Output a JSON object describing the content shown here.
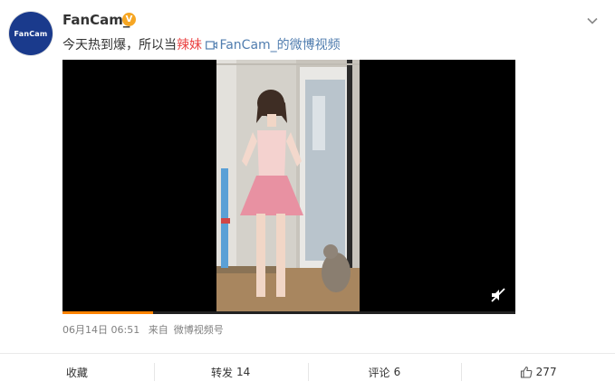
{
  "author": {
    "name": "FanCam_",
    "avatar_text": "FanCam",
    "badge": "V"
  },
  "post": {
    "text_prefix": "今天热到爆，所以当",
    "text_highlight": "辣妹",
    "video_link": "FanCam_的微博视频"
  },
  "video": {
    "progress_fraction": 0.2
  },
  "meta": {
    "date": "06月14日 06:51",
    "source_prefix": "来自",
    "source": "微博视频号"
  },
  "actions": {
    "favorite": "收藏",
    "repost_label": "转发",
    "repost_count": "14",
    "comment_label": "评论",
    "comment_count": "6",
    "like_count": "277"
  },
  "colors": {
    "accent": "#ff8200",
    "link": "#507daf",
    "highlight": "#eb4444",
    "badge": "#f6a623"
  }
}
